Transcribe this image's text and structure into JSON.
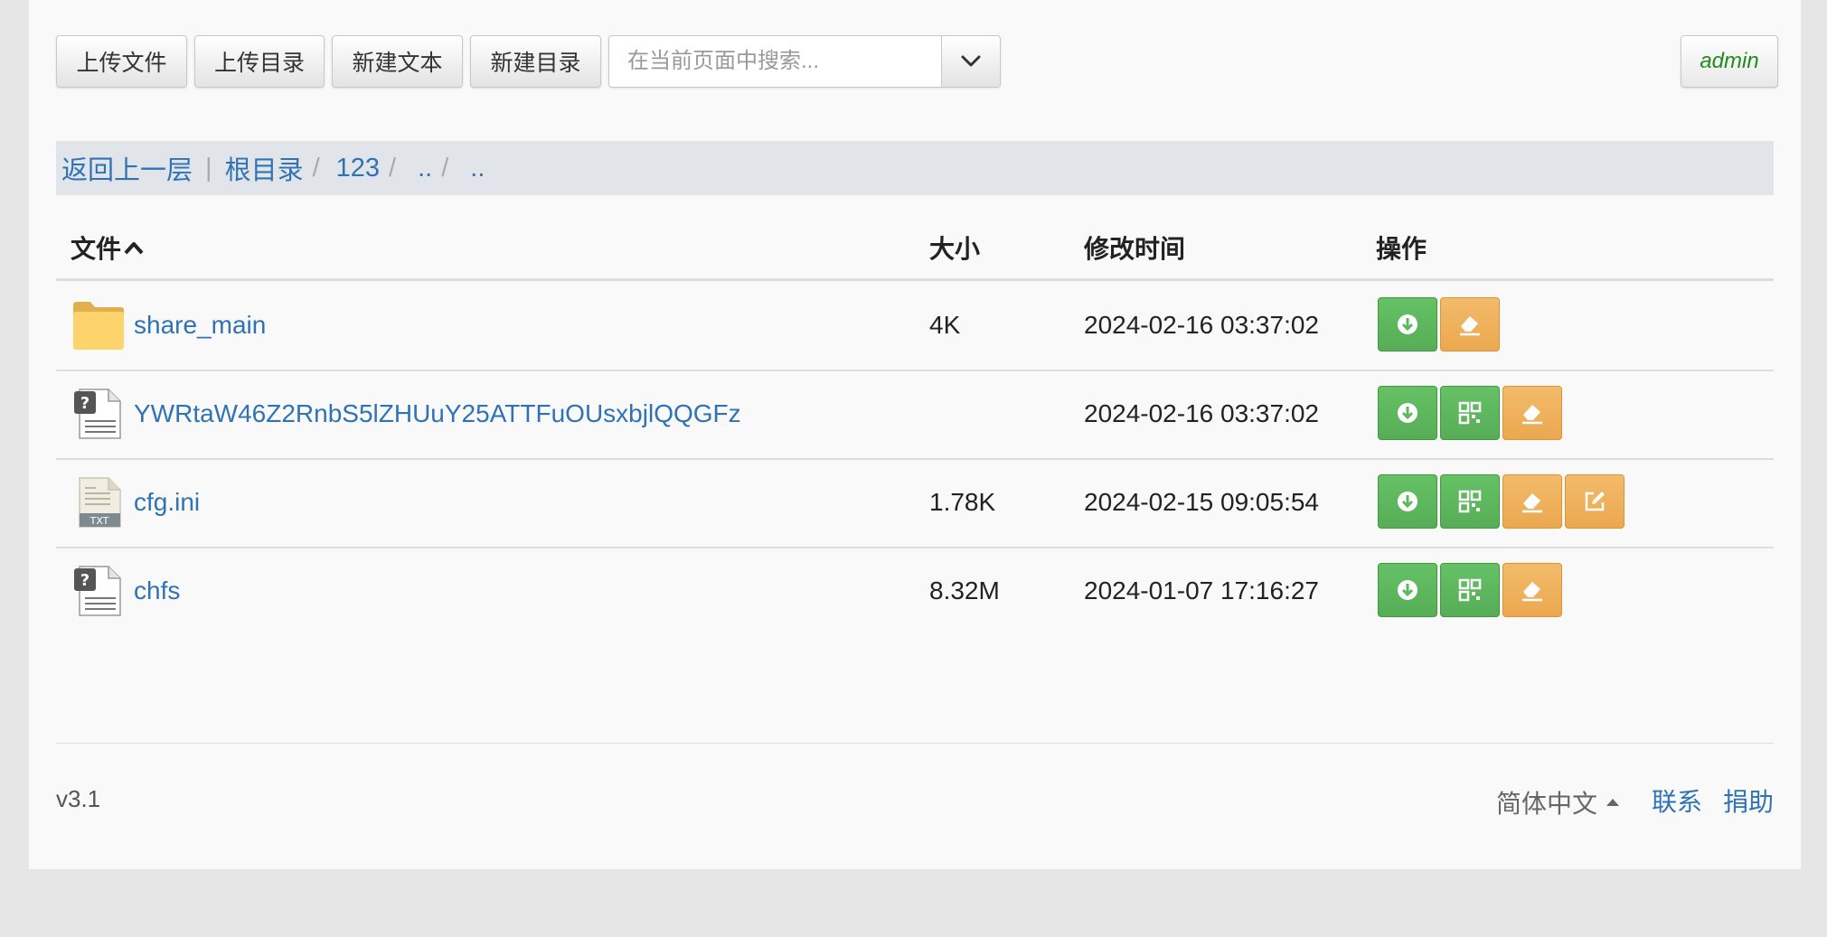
{
  "toolbar": {
    "upload_file": "上传文件",
    "upload_dir": "上传目录",
    "new_text": "新建文本",
    "new_dir": "新建目录",
    "search_placeholder": "在当前页面中搜索...",
    "user": "admin"
  },
  "breadcrumb": {
    "back": "返回上一层",
    "divider": "|",
    "root": "根目录",
    "items": [
      "123",
      "..",
      ".."
    ]
  },
  "table": {
    "headers": {
      "file": "文件",
      "size": "大小",
      "mtime": "修改时间",
      "ops": "操作"
    },
    "sort_indicator": "chevron-up-icon",
    "rows": [
      {
        "name": "share_main",
        "size": "4K",
        "mtime": "2024-02-16 03:37:02",
        "type": "folder",
        "actions": [
          "download-icon",
          "erase-icon"
        ]
      },
      {
        "name": "YWRtaW46Z2RnbS5lZHUuY25ATTFuOUsxbjlQQGFz",
        "size": "",
        "mtime": "2024-02-16 03:37:02",
        "type": "unknown",
        "actions": [
          "download-icon",
          "qrcode-icon",
          "erase-icon"
        ]
      },
      {
        "name": "cfg.ini",
        "size": "1.78K",
        "mtime": "2024-02-15 09:05:54",
        "type": "txt",
        "actions": [
          "download-icon",
          "qrcode-icon",
          "erase-icon",
          "edit-icon"
        ]
      },
      {
        "name": "chfs",
        "size": "8.32M",
        "mtime": "2024-01-07 17:16:27",
        "type": "unknown",
        "actions": [
          "download-icon",
          "qrcode-icon",
          "erase-icon"
        ]
      }
    ]
  },
  "footer": {
    "version": "v3.1",
    "language": "简体中文",
    "contact": "联系",
    "donate": "捐助"
  },
  "colors": {
    "link": "#2f72b5",
    "success": "#5cb85c",
    "warning": "#f0ad4e",
    "breadcrumb_bg": "#e1e5ea"
  }
}
